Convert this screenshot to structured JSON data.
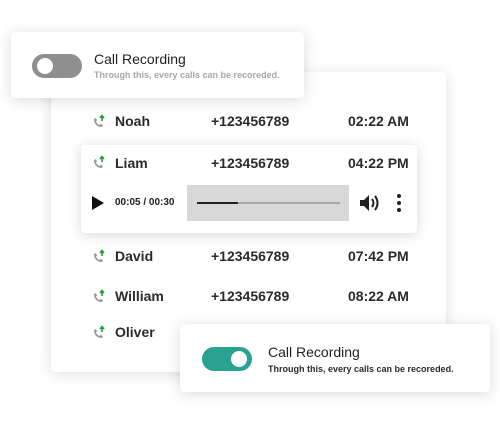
{
  "colors": {
    "toggle_off": "#8f8f8f",
    "toggle_on": "#2aa291",
    "call_arrow": "#1e9e3c",
    "phone_icon": "#9a9a9a"
  },
  "top_toggle": {
    "title": "Call Recording",
    "subtitle": "Through this, every calls can be recoreded.",
    "state": "off"
  },
  "bottom_toggle": {
    "title": "Call Recording",
    "subtitle": "Through this, every calls can be recoreded.",
    "state": "on"
  },
  "calls": [
    {
      "name": "Noah",
      "number": "+123456789",
      "time": "02:22 AM",
      "icon": "outgoing-call-icon"
    },
    {
      "name": "Liam",
      "number": "+123456789",
      "time": "04:22 PM",
      "icon": "outgoing-call-icon"
    },
    {
      "name": "David",
      "number": "+123456789",
      "time": "07:42 PM",
      "icon": "outgoing-call-icon"
    },
    {
      "name": "William",
      "number": "+123456789",
      "time": "08:22 AM",
      "icon": "outgoing-call-icon"
    },
    {
      "name": "Oliver",
      "number": "",
      "time": "",
      "icon": "outgoing-call-icon"
    }
  ],
  "player": {
    "timecode": "00:05 / 00:30",
    "progress": 0.29
  }
}
